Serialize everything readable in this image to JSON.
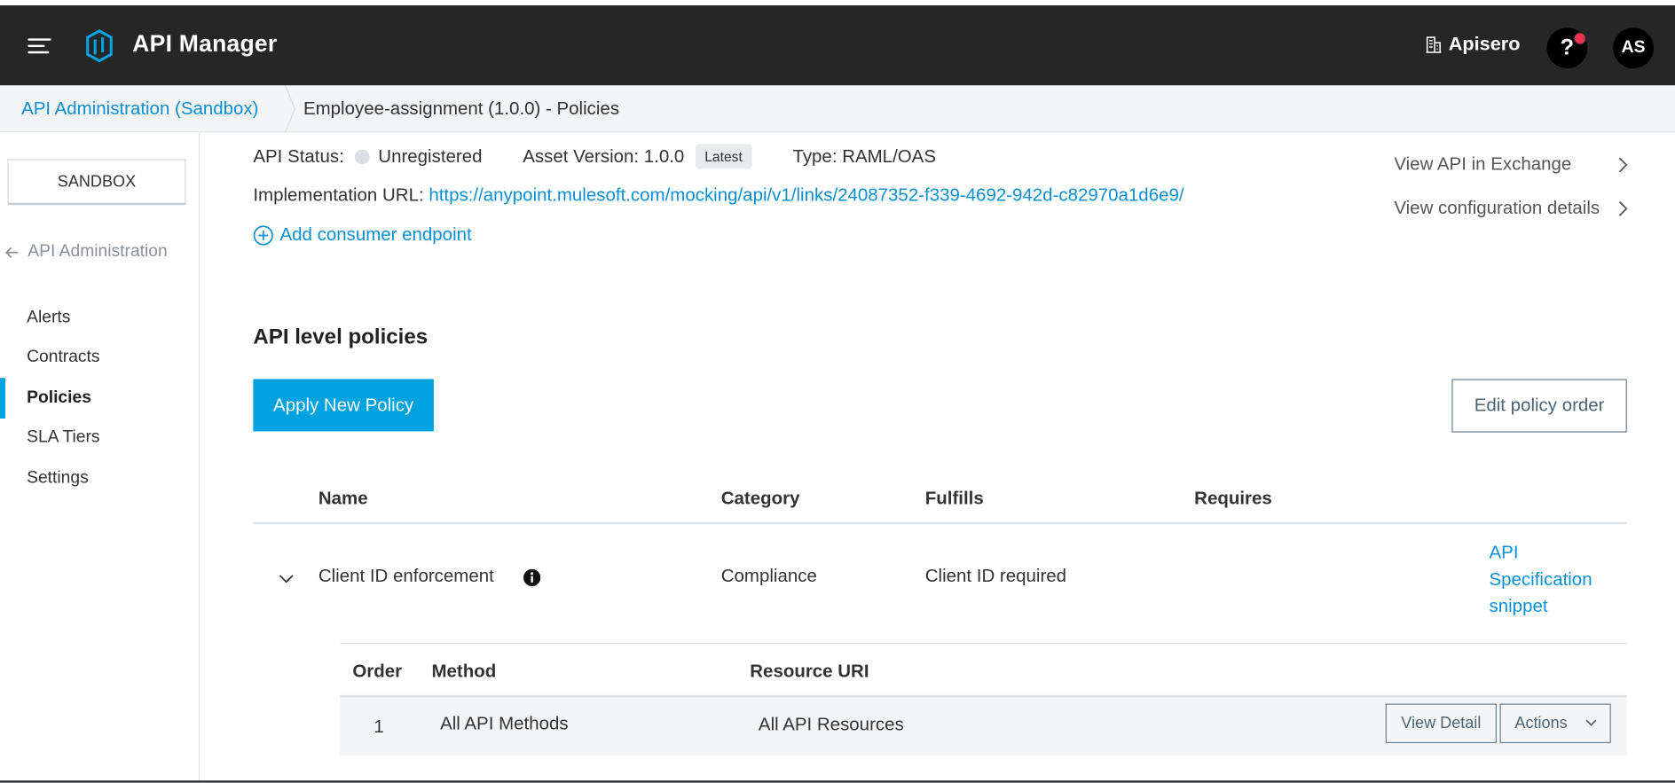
{
  "header": {
    "app_title": "API Manager",
    "org_name": "Apisero",
    "help_label": "?",
    "avatar_initials": "AS",
    "brand_color": "#262626",
    "accent_color": "#00a2df",
    "notification_color": "#e8344e"
  },
  "breadcrumb": {
    "parent": "API Administration (Sandbox)",
    "current": "Employee-assignment (1.0.0) - Policies"
  },
  "sidebar": {
    "environment": "SANDBOX",
    "back_label": "API Administration",
    "items": [
      {
        "label": "Alerts",
        "active": false
      },
      {
        "label": "Contracts",
        "active": false
      },
      {
        "label": "Policies",
        "active": true
      },
      {
        "label": "SLA Tiers",
        "active": false
      },
      {
        "label": "Settings",
        "active": false
      }
    ]
  },
  "api_info": {
    "status_label": "API Status:",
    "status_value": "Unregistered",
    "asset_version_label": "Asset Version: 1.0.0",
    "latest_badge": "Latest",
    "type_label": "Type: RAML/OAS",
    "impl_url_label": "Implementation URL:",
    "impl_url": "https://anypoint.mulesoft.com/mocking/api/v1/links/24087352-f339-4692-942d-c82970a1d6e9/",
    "add_endpoint": "Add consumer endpoint",
    "view_exchange": "View API in Exchange",
    "view_config": "View configuration details"
  },
  "policies": {
    "section_title": "API level policies",
    "apply_button": "Apply New Policy",
    "edit_order_button": "Edit policy order",
    "columns": [
      "Name",
      "Category",
      "Fulfills",
      "Requires"
    ],
    "rows": [
      {
        "name": "Client ID enforcement",
        "category": "Compliance",
        "fulfills": "Client ID required",
        "requires": "",
        "spec_link": "API Specification snippet",
        "sub_columns": [
          "Order",
          "Method",
          "Resource URI"
        ],
        "sub_rows": [
          {
            "order": "1",
            "method": "All API Methods",
            "resource_uri": "All API Resources",
            "view_detail": "View Detail",
            "actions": "Actions"
          }
        ]
      }
    ]
  }
}
